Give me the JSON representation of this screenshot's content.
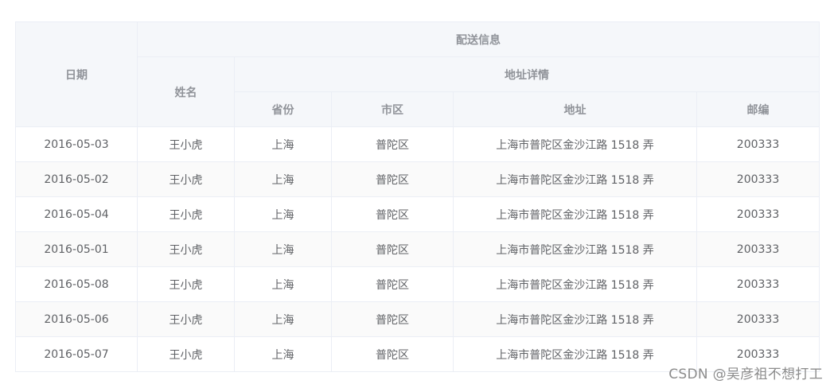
{
  "table": {
    "header": {
      "date": "日期",
      "delivery": "配送信息",
      "name": "姓名",
      "address_detail": "地址详情",
      "province": "省份",
      "city": "市区",
      "address": "地址",
      "zip": "邮编"
    },
    "rows": [
      {
        "date": "2016-05-03",
        "name": "王小虎",
        "province": "上海",
        "city": "普陀区",
        "address": "上海市普陀区金沙江路 1518 弄",
        "zip": "200333"
      },
      {
        "date": "2016-05-02",
        "name": "王小虎",
        "province": "上海",
        "city": "普陀区",
        "address": "上海市普陀区金沙江路 1518 弄",
        "zip": "200333"
      },
      {
        "date": "2016-05-04",
        "name": "王小虎",
        "province": "上海",
        "city": "普陀区",
        "address": "上海市普陀区金沙江路 1518 弄",
        "zip": "200333"
      },
      {
        "date": "2016-05-01",
        "name": "王小虎",
        "province": "上海",
        "city": "普陀区",
        "address": "上海市普陀区金沙江路 1518 弄",
        "zip": "200333"
      },
      {
        "date": "2016-05-08",
        "name": "王小虎",
        "province": "上海",
        "city": "普陀区",
        "address": "上海市普陀区金沙江路 1518 弄",
        "zip": "200333"
      },
      {
        "date": "2016-05-06",
        "name": "王小虎",
        "province": "上海",
        "city": "普陀区",
        "address": "上海市普陀区金沙江路 1518 弄",
        "zip": "200333"
      },
      {
        "date": "2016-05-07",
        "name": "王小虎",
        "province": "上海",
        "city": "普陀区",
        "address": "上海市普陀区金沙江路 1518 弄",
        "zip": "200333"
      }
    ]
  },
  "watermark": "CSDN @吴彦祖不想打工"
}
